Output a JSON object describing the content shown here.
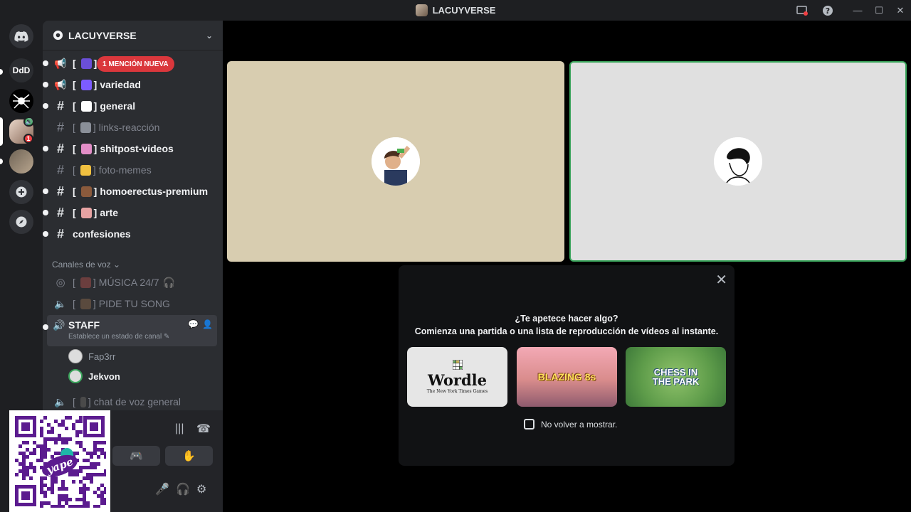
{
  "window": {
    "title": "LACUYVERSE"
  },
  "rail": {
    "server_ddd": "DdD",
    "badge_count": "1"
  },
  "server": {
    "name": "LACUYVERSE"
  },
  "mention_banner": "1 MENCIÓN NUEVA",
  "channels": [
    {
      "name": "",
      "type": "announce",
      "state": "unread",
      "emoji_color": "#6b4fd8"
    },
    {
      "name": "variedad",
      "type": "announce",
      "state": "unread",
      "emoji_color": "#7c5cff"
    },
    {
      "name": "general",
      "type": "text",
      "state": "unread",
      "emoji_color": "#ffffff"
    },
    {
      "name": "links-reacción",
      "type": "text",
      "state": "read",
      "emoji_color": "#8a8f98"
    },
    {
      "name": "shitpost-videos",
      "type": "text",
      "state": "unread",
      "emoji_color": "#e38ec7"
    },
    {
      "name": "foto-memes",
      "type": "text",
      "state": "read",
      "emoji_color": "#f0c040"
    },
    {
      "name": "homoerectus-premium",
      "type": "text",
      "state": "unread",
      "emoji_color": "#8a5a3c"
    },
    {
      "name": "arte",
      "type": "text",
      "state": "unread",
      "emoji_color": "#e7a3a3"
    },
    {
      "name": "confesiones",
      "type": "text",
      "state": "unread",
      "emoji_color": ""
    }
  ],
  "voice_category": "Canales de voz",
  "voice_channels": {
    "musica": "MÚSICA 24/7",
    "pide": "PIDE TU SONG",
    "staff": "STAFF",
    "staff_status": "Establece un estado de canal",
    "general": "chat de voz general"
  },
  "voice_users": [
    "Fap3rr",
    "Jekvon"
  ],
  "activity": {
    "heading": "¿Te apetece hacer algo?",
    "subheading": "Comienza una partida o una lista de reproducción de vídeos al instante.",
    "cards": [
      "Wordle",
      "BLAZING 8s",
      "CHESS IN THE PARK"
    ],
    "wordle_sub": "The New York Times Games",
    "checkbox_label": "No volver a mostrar."
  },
  "colors": {
    "accent_green": "#3ba55c",
    "mention_red": "#da373c",
    "tile_left": "#d8cdb0",
    "tile_right": "#e0e0e0"
  }
}
